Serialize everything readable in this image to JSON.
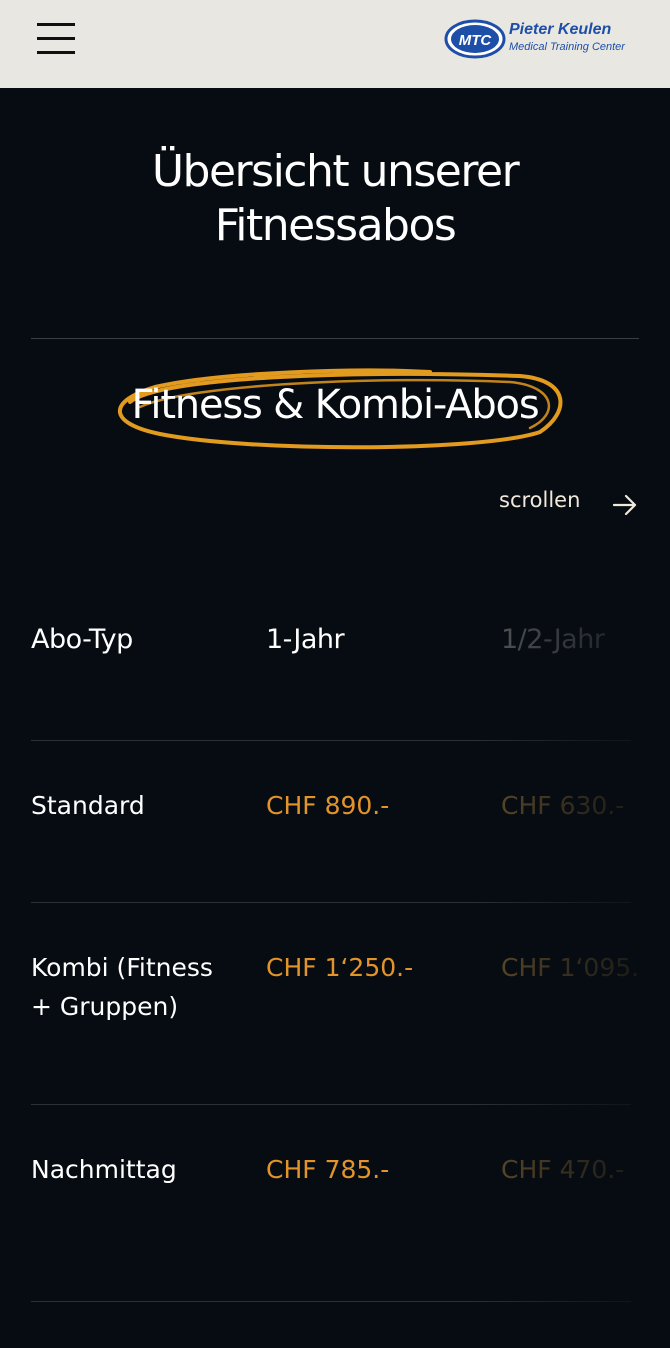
{
  "header": {
    "menu_icon": "hamburger-menu-icon",
    "logo": {
      "badge": "MTC",
      "name": "Pieter Keulen",
      "tagline": "Medical Training Center",
      "color": "#1e4fa8"
    }
  },
  "page": {
    "title_line1": "Übersicht unserer",
    "title_line2": "Fitnessabos"
  },
  "section": {
    "title": "Fitness & Kombi-Abos",
    "highlight_color": "#e29a1f"
  },
  "scroll_hint": {
    "label": "scrollen",
    "icon": "arrow-right-icon"
  },
  "table": {
    "headers": [
      "Abo-Typ",
      "1-Jahr",
      "1/2-Jahr"
    ],
    "rows": [
      {
        "type": "Standard",
        "year": "CHF 890.-",
        "half": "CHF 630.-"
      },
      {
        "type_line1": "Kombi (Fitness",
        "type_line2": "+ Gruppen)",
        "year": "CHF 1‘250.-",
        "half": "CHF 1‘095."
      },
      {
        "type": "Nachmittag",
        "year": "CHF 785.-",
        "half": "CHF 470.-"
      }
    ],
    "price_color": "#e2942a"
  }
}
